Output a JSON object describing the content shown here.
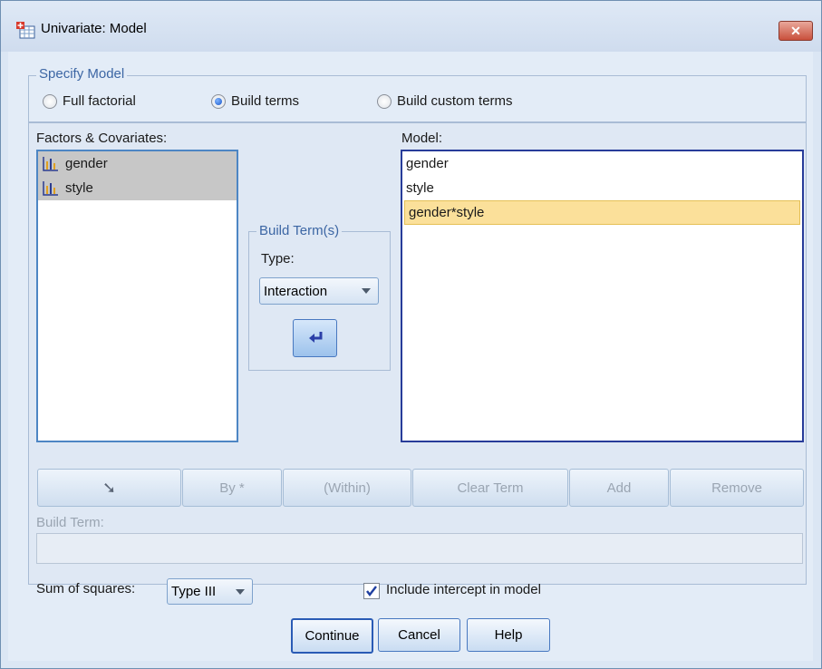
{
  "window": {
    "title": "Univariate: Model",
    "close_label": "✕"
  },
  "specify_model": {
    "label": "Specify Model",
    "options": [
      "Full factorial",
      "Build terms",
      "Build custom terms"
    ],
    "selected": "Build terms"
  },
  "factors": {
    "label": "Factors & Covariates:",
    "items": [
      "gender",
      "style"
    ]
  },
  "build_terms": {
    "label": "Build Term(s)",
    "type_label": "Type:",
    "type_value": "Interaction",
    "arrow_icon": "arrow-curve-left-icon"
  },
  "model": {
    "label": "Model:",
    "items": [
      "gender",
      "style",
      "gender*style"
    ],
    "selected": "gender*style"
  },
  "term_buttons": {
    "down_arrow": "➘",
    "by": "By *",
    "within": "(Within)",
    "clear_term": "Clear Term",
    "add": "Add",
    "remove": "Remove"
  },
  "build_term": {
    "label": "Build Term:",
    "value": ""
  },
  "sum_of_squares": {
    "label": "Sum of squares:",
    "value": "Type III"
  },
  "intercept": {
    "label": "Include intercept in model",
    "checked": true
  },
  "footer_buttons": {
    "continue": "Continue",
    "cancel": "Cancel",
    "help": "Help"
  }
}
